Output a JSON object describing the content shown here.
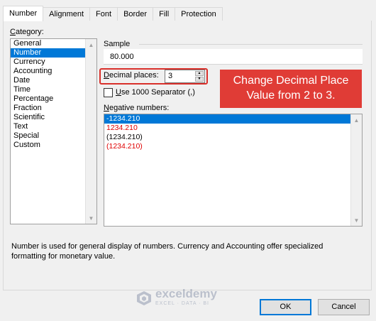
{
  "tabs": [
    {
      "label": "Number"
    },
    {
      "label": "Alignment"
    },
    {
      "label": "Font"
    },
    {
      "label": "Border"
    },
    {
      "label": "Fill"
    },
    {
      "label": "Protection"
    }
  ],
  "category": {
    "label_underlined": "C",
    "label_rest": "ategory:",
    "items": [
      "General",
      "Number",
      "Currency",
      "Accounting",
      "Date",
      "Time",
      "Percentage",
      "Fraction",
      "Scientific",
      "Text",
      "Special",
      "Custom"
    ],
    "selected": "Number"
  },
  "sample": {
    "label": "Sample",
    "value": "80.000"
  },
  "decimal_places": {
    "label_underlined": "D",
    "label_rest": "ecimal places:",
    "value": "3"
  },
  "separator": {
    "label_underlined": "U",
    "label_rest": "se 1000 Separator (,)",
    "checked": false
  },
  "callout": {
    "line1": "Change Decimal Place",
    "line2": "Value from 2 to 3.",
    "color": "#e03c36"
  },
  "negative_numbers": {
    "label_underlined": "N",
    "label_rest": "egative numbers:",
    "items": [
      {
        "text": "-1234.210",
        "style": "selected"
      },
      {
        "text": "1234.210",
        "style": "red"
      },
      {
        "text": "(1234.210)",
        "style": "black"
      },
      {
        "text": "(1234.210)",
        "style": "red"
      }
    ]
  },
  "description": {
    "line1": "Number is used for general display of numbers.  Currency and Accounting offer specialized",
    "line2": "formatting for monetary value."
  },
  "watermark": {
    "name": "exceldemy",
    "tagline": "EXCEL · DATA · BI"
  },
  "buttons": {
    "ok": "OK",
    "cancel": "Cancel"
  },
  "colors": {
    "selection": "#0078d7",
    "negative_red": "#e00000",
    "highlight_border": "#d9302b"
  }
}
